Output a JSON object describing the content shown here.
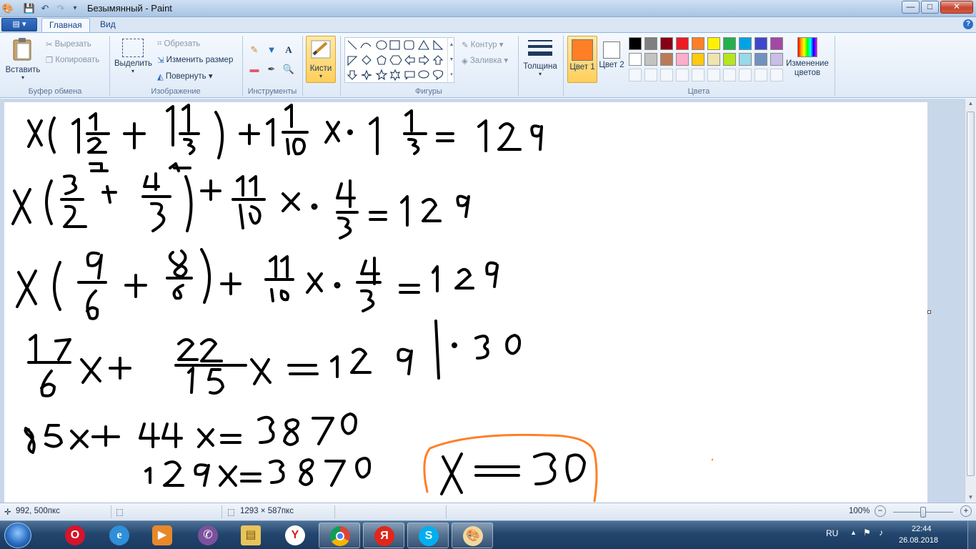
{
  "window": {
    "title": "Безымянный - Paint",
    "controls": {
      "minimize": "—",
      "maximize": "□",
      "close": "✕"
    }
  },
  "quick_access": [
    "save-icon",
    "undo-icon",
    "redo-icon",
    "customize-icon"
  ],
  "tabs": {
    "file_menu": "▤ ▾",
    "home": "Главная",
    "view": "Вид"
  },
  "ribbon": {
    "clipboard": {
      "label": "Буфер обмена",
      "paste": "Вставить",
      "cut": "Вырезать",
      "copy": "Копировать"
    },
    "image": {
      "label": "Изображение",
      "select": "Выделить",
      "crop": "Обрезать",
      "resize": "Изменить размер",
      "rotate": "Повернуть"
    },
    "tools": {
      "label": "Инструменты"
    },
    "brushes": {
      "label": "Кисти"
    },
    "shapes": {
      "label": "Фигуры",
      "outline": "Контур",
      "fill": "Заливка"
    },
    "size": {
      "label": "Толщина"
    },
    "colors": {
      "label": "Цвета",
      "color1": "Цвет 1",
      "color2": "Цвет 2",
      "edit": "Изменение цветов",
      "color1_value": "#ff7f27",
      "color2_value": "#ffffff",
      "palette_row1": [
        "#000000",
        "#7f7f7f",
        "#880015",
        "#ed1c24",
        "#ff7f27",
        "#fff200",
        "#22b14c",
        "#00a2e8",
        "#3f48cc",
        "#a349a4"
      ],
      "palette_row2": [
        "#ffffff",
        "#c3c3c3",
        "#b97a57",
        "#ffaec9",
        "#ffc90e",
        "#efe4b0",
        "#b5e61d",
        "#99d9ea",
        "#7092be",
        "#c8bfe7"
      ]
    }
  },
  "status": {
    "cursor_pos": "992, 500пкс",
    "image_size": "1293 × 587пкс",
    "zoom": "100%"
  },
  "taskbar": {
    "apps": [
      "opera-icon",
      "internet-explorer-icon",
      "media-player-icon",
      "viber-icon",
      "file-explorer-icon",
      "yandex-icon",
      "chrome-icon",
      "yandex-browser-icon",
      "skype-icon",
      "paint-icon"
    ],
    "lang": "RU",
    "time": "22:44",
    "date": "26.08.2018"
  }
}
